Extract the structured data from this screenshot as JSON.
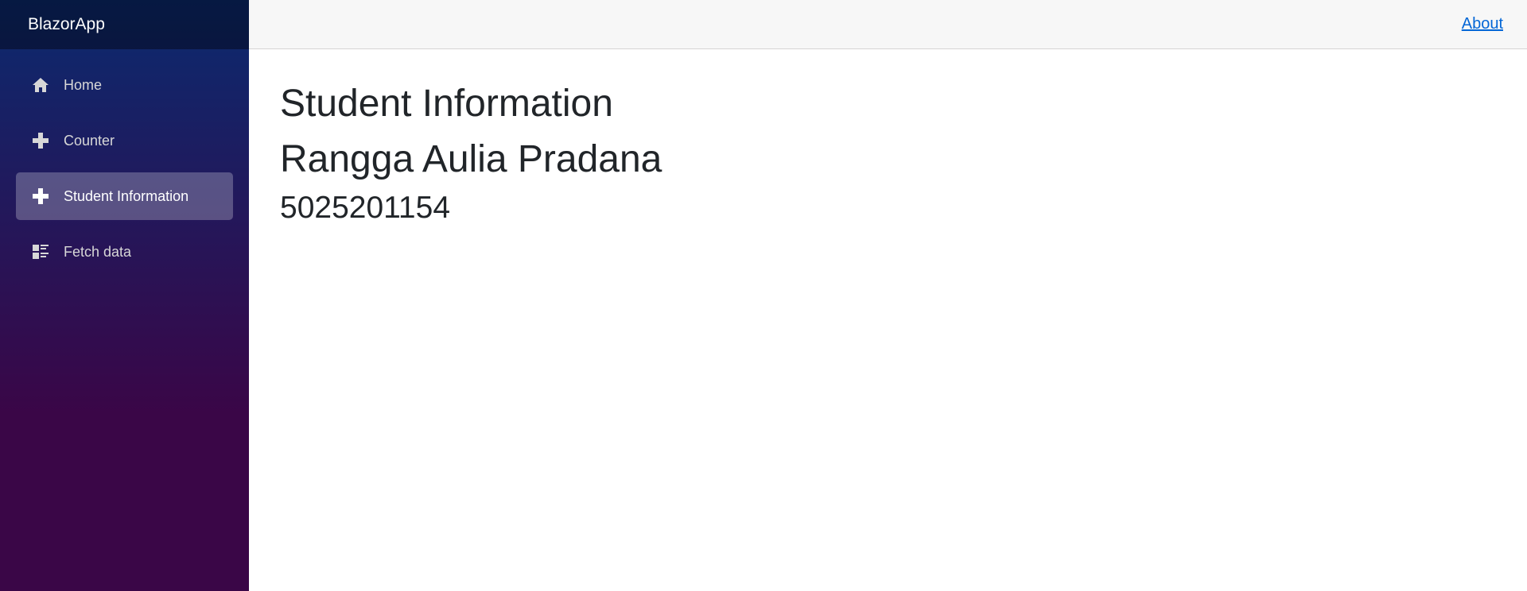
{
  "brand": {
    "name": "BlazorApp"
  },
  "sidebar": {
    "items": [
      {
        "label": "Home",
        "icon": "home-icon"
      },
      {
        "label": "Counter",
        "icon": "plus-icon"
      },
      {
        "label": "Student Information",
        "icon": "plus-icon",
        "active": true
      },
      {
        "label": "Fetch data",
        "icon": "list-rich-icon"
      }
    ]
  },
  "header": {
    "about_label": "About"
  },
  "main": {
    "title": "Student Information",
    "student_name": "Rangga Aulia Pradana",
    "student_id": "5025201154"
  },
  "colors": {
    "sidebar_gradient_top": "#0b2a6f",
    "sidebar_gradient_bottom": "#3a0647",
    "link": "#0366d6",
    "top_row_bg": "#f7f7f7",
    "text": "#212529"
  }
}
